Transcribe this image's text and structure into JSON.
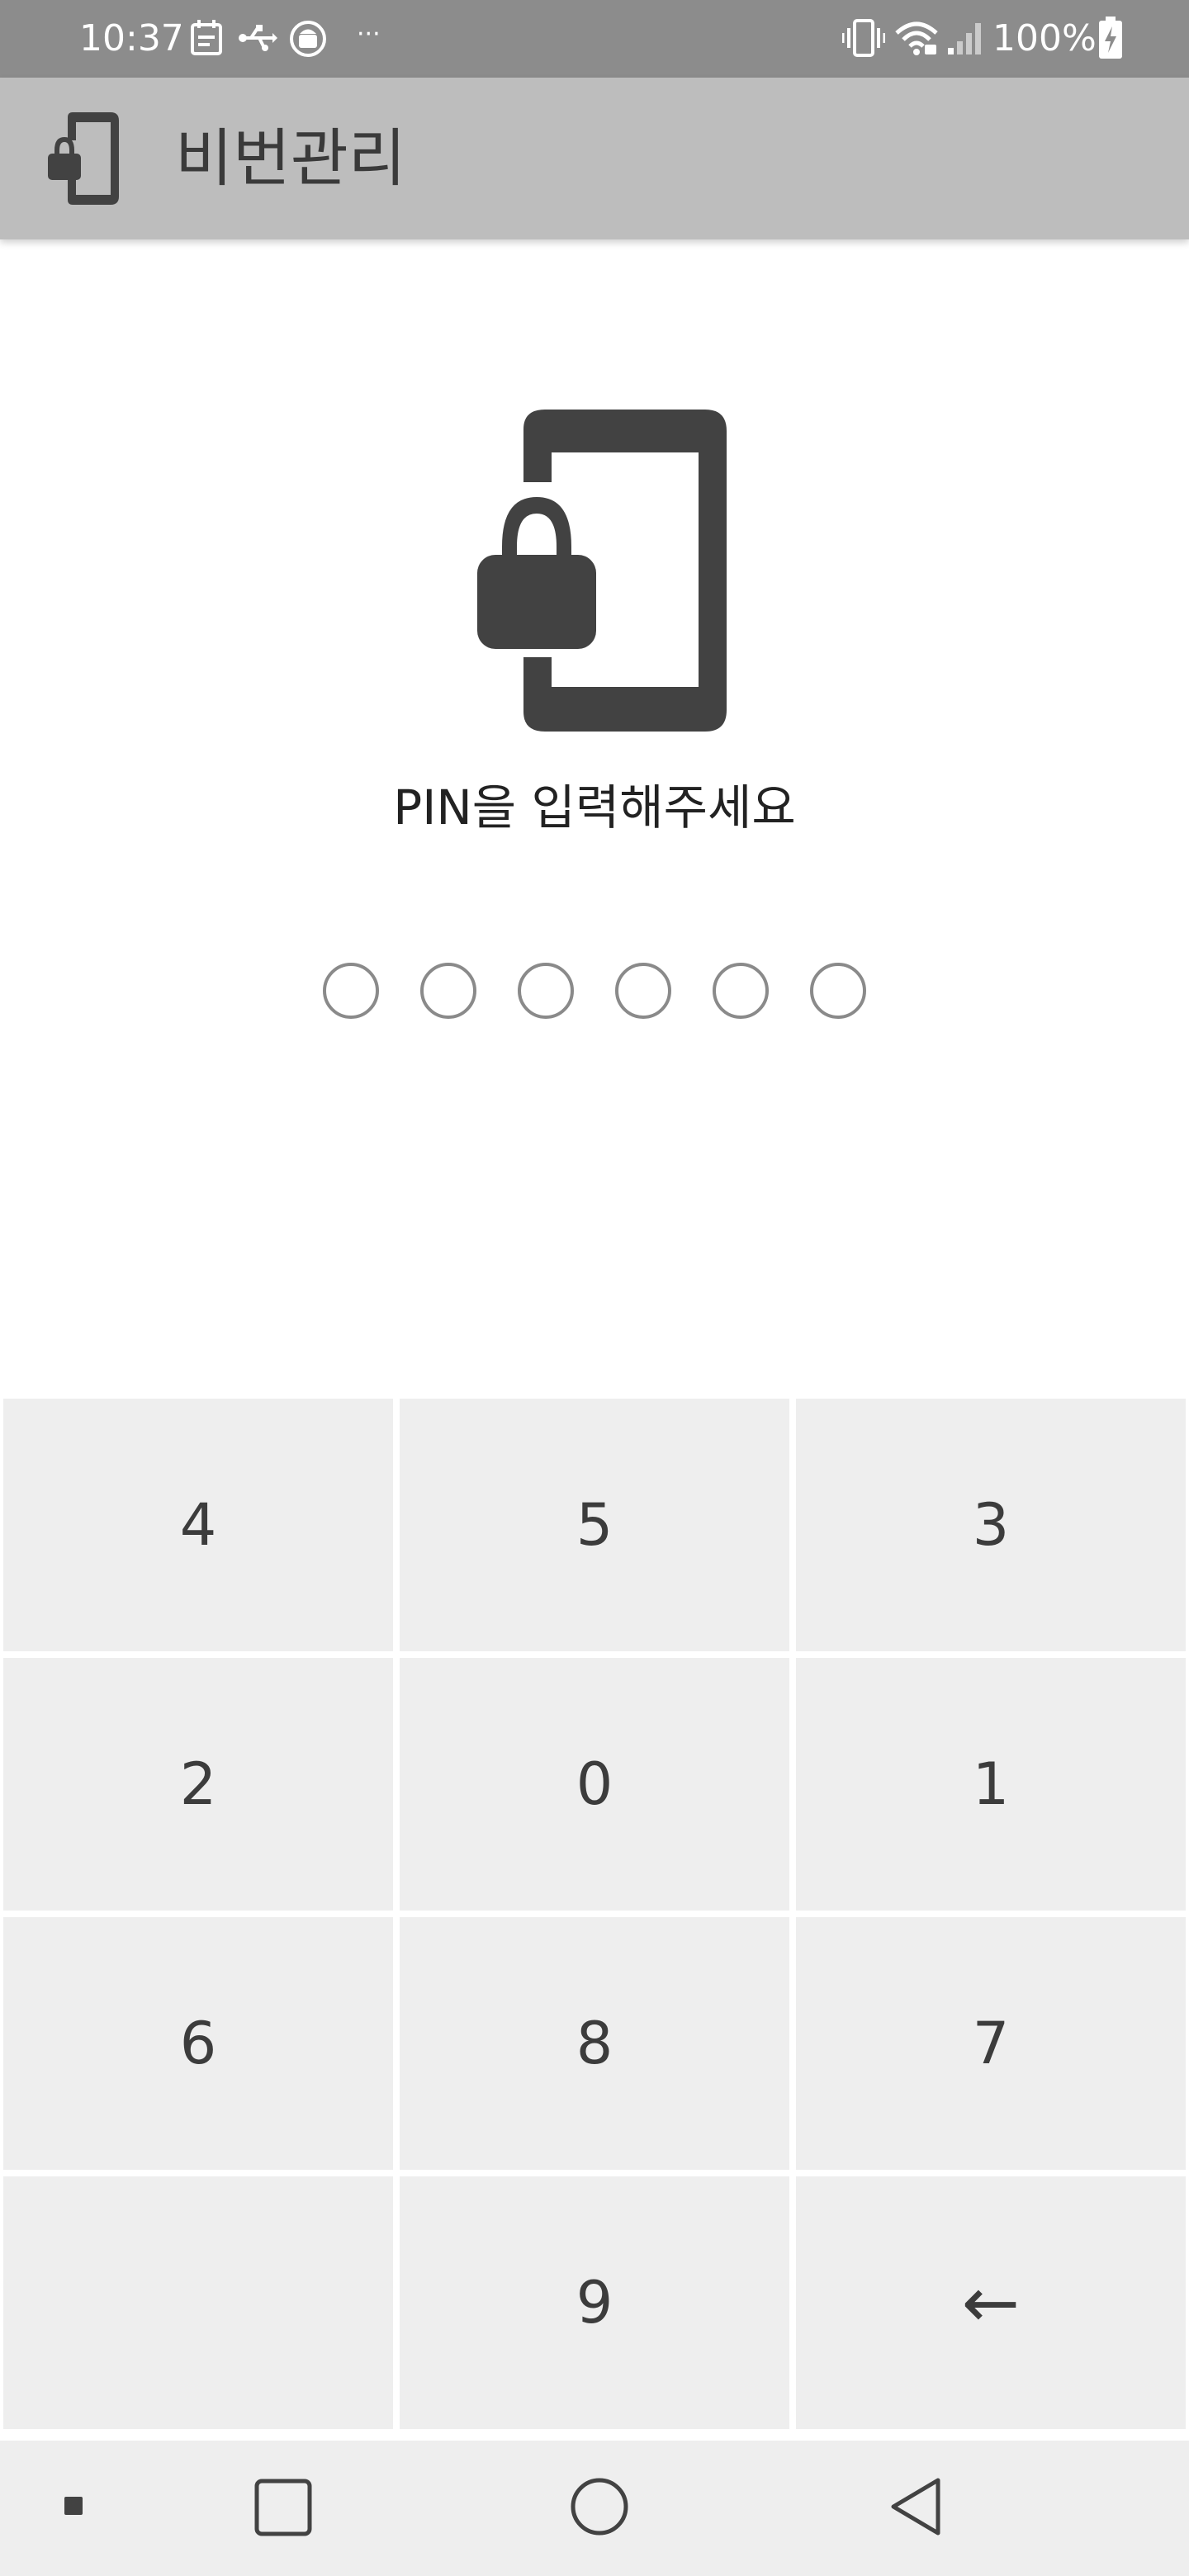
{
  "status_bar": {
    "time": "10:37",
    "overflow": "···",
    "battery_percent": "100%",
    "icons_left": [
      "calendar-icon",
      "usb-icon",
      "android-debug-icon"
    ],
    "icons_right": [
      "vibrate-icon",
      "wifi-icon",
      "signal-icon",
      "battery-charging-icon"
    ]
  },
  "app_bar": {
    "icon": "phone-lock-icon",
    "title": "비번관리"
  },
  "lock_screen": {
    "illustration": "phone-lock-icon",
    "prompt": "PIN을 입력해주세요",
    "pin_length": 6
  },
  "keypad": {
    "keys": [
      {
        "label": "4"
      },
      {
        "label": "5"
      },
      {
        "label": "3"
      },
      {
        "label": "2"
      },
      {
        "label": "0"
      },
      {
        "label": "1"
      },
      {
        "label": "6"
      },
      {
        "label": "8"
      },
      {
        "label": "7"
      },
      {
        "label": ""
      },
      {
        "label": "9"
      },
      {
        "label": "←"
      }
    ]
  },
  "nav_bar": {
    "buttons": [
      "notification-dot-icon",
      "recents-icon",
      "home-icon",
      "back-icon"
    ]
  },
  "colors": {
    "status_bar_bg": "#8c8c8c",
    "app_bar_bg": "#bdbdbd",
    "key_bg": "#eeeeee",
    "icon_dark": "#424242",
    "dot_border": "#8a8a8a"
  }
}
